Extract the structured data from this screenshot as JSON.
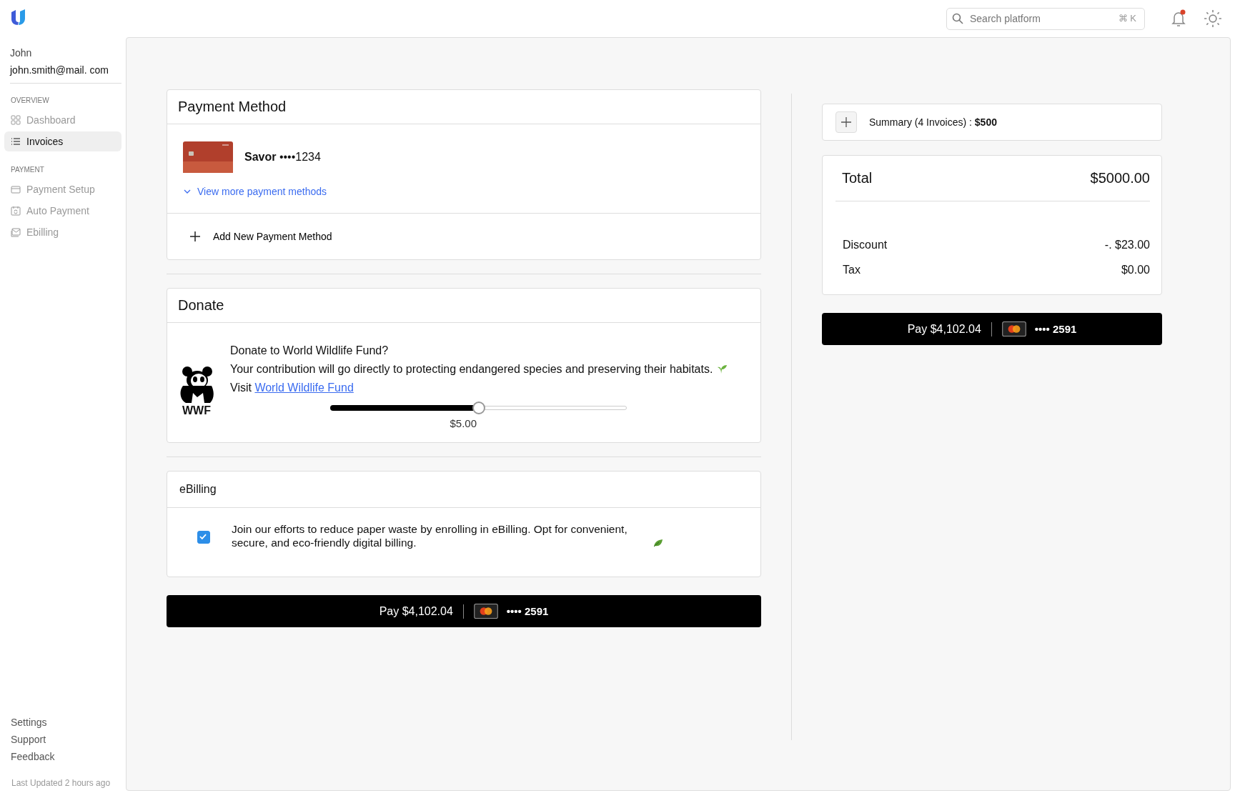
{
  "header": {
    "search": {
      "placeholder": "Search platform",
      "shortcut": "⌘ K"
    },
    "notifications": {
      "unread": true
    }
  },
  "user": {
    "name": "John",
    "email": "john.smith@mail. com"
  },
  "nav_sections": [
    {
      "title": "OVERVIEW",
      "items": [
        {
          "label": "Dashboard",
          "selected": false
        },
        {
          "label": "Invoices",
          "selected": true
        }
      ]
    },
    {
      "title": "PAYMENT",
      "items": [
        {
          "label": "Payment Setup",
          "selected": false
        },
        {
          "label": "Auto Payment",
          "selected": false
        },
        {
          "label": "Ebilling",
          "selected": false
        }
      ]
    }
  ],
  "footer_links": [
    "Settings",
    "Support",
    "Feedback"
  ],
  "last_updated": "Last Updated 2 hours ago",
  "payment_method": {
    "title": "Payment Method",
    "card": "**Savor** ••••1234",
    "more_link": "View more payment methods",
    "add_label": "Add New Payment Method"
  },
  "donate": {
    "title": "Donate",
    "logo_text": "WWF",
    "question": "Donate to World Wildlife Fund?",
    "description": "Your contribution will go directly to protecting endangered species and preserving their habitats.",
    "visit_prefix": "Visit",
    "link": "World Wildlife Fund",
    "level": 0.5,
    "amount": "$5.00"
  },
  "ebilling": {
    "title": "eBilling",
    "checked": true,
    "text": "Join our efforts to reduce paper waste by enrolling in eBilling. Opt for convenient, secure, and eco-friendly digital billing."
  },
  "pay_button": {
    "label": "Pay $4,102.04",
    "card": "•••• 2591"
  },
  "summary": {
    "label": "Summary (4 Invoices) : **$500**",
    "total_label": "Total",
    "total": "$5000.00",
    "rows": [
      {
        "label": "Discount",
        "value": "-. $23.00"
      },
      {
        "label": "Tax",
        "value": "$0.00"
      }
    ],
    "pay_button": {
      "label": "Pay $4,102.04",
      "card": "•••• 2591"
    }
  }
}
